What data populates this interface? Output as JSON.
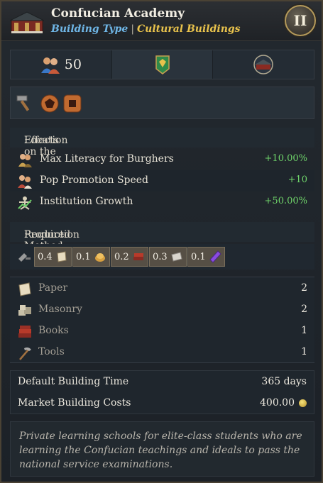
{
  "header": {
    "title": "Confucian Academy",
    "building_type_label": "Building Type",
    "separator": "|",
    "category": "Cultural Buildings",
    "tier": "II",
    "building_icon": "academy-building-icon"
  },
  "stats": {
    "population_icon": "population-icon",
    "population": "50",
    "banner_icon": "green-banner-icon",
    "location_icon": "location-building-icon"
  },
  "tools": [
    "hammer-icon",
    "pentagon-slot-icon",
    "square-slot-icon"
  ],
  "effects": {
    "heading_prefix": "Effects on the",
    "heading_highlight": "Location",
    "heading_suffix": ":",
    "items": [
      {
        "label": "Max Literacy for Burghers",
        "value": "+10.00%",
        "icon": "burghers-icon"
      },
      {
        "label": "Pop Promotion Speed",
        "value": "+10",
        "icon": "pop-promotion-icon"
      },
      {
        "label": "Institution Growth",
        "value": "+50.00%",
        "icon": "institution-icon"
      }
    ]
  },
  "production": {
    "heading_prefix": "Required",
    "heading_highlight": "Production Method",
    "heading_suffix": ":",
    "method_icon": "production-method-icon",
    "chips": [
      {
        "value": "0.4",
        "icon": "paper-icon"
      },
      {
        "value": "0.1",
        "icon": "bread-icon"
      },
      {
        "value": "0.2",
        "icon": "books-icon"
      },
      {
        "value": "0.3",
        "icon": "cloth-icon"
      },
      {
        "value": "0.1",
        "icon": "crystal-icon"
      }
    ]
  },
  "goods": [
    {
      "label": "Paper",
      "value": "2",
      "icon": "paper-icon"
    },
    {
      "label": "Masonry",
      "value": "2",
      "icon": "masonry-icon"
    },
    {
      "label": "Books",
      "value": "1",
      "icon": "books-icon"
    },
    {
      "label": "Tools",
      "value": "1",
      "icon": "tools-icon"
    }
  ],
  "costs": {
    "time_label": "Default Building Time",
    "time_value": "365 days",
    "market_label": "Market Building Costs",
    "market_value": "400.00",
    "coin_icon": "gold-coin-icon"
  },
  "description": "Private learning schools for elite-class students who are learning the Confucian teachings and ideals to pass the national service examinations.",
  "colors": {
    "accent_blue": "#6fb6e6",
    "accent_gold": "#e8c24c",
    "positive_green": "#6fd36a"
  }
}
